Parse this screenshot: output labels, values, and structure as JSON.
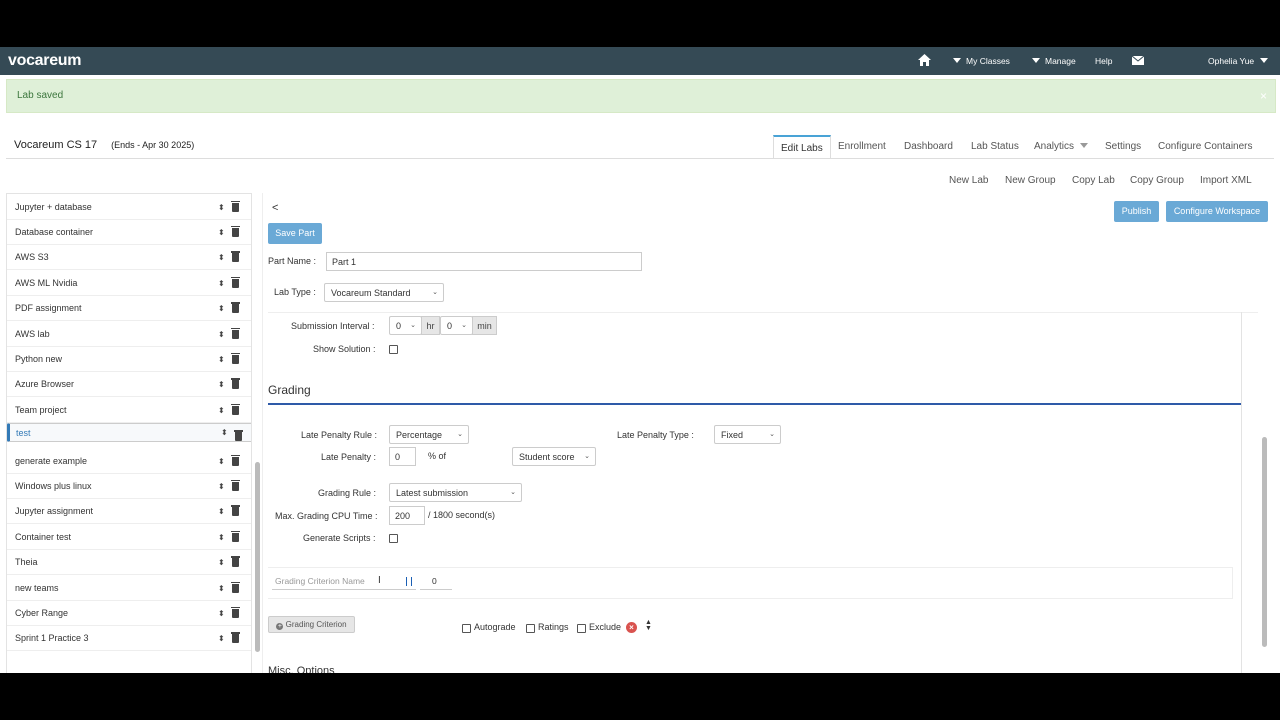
{
  "topbar": {
    "logo": "vocareum",
    "my_classes": "My Classes",
    "manage": "Manage",
    "help": "Help",
    "user": "Ophelia Yue"
  },
  "alert": {
    "text": "Lab saved",
    "close": "×"
  },
  "course": {
    "name": "Vocareum CS 17",
    "ends": "(Ends - Apr 30 2025)"
  },
  "tabs": {
    "edit_labs": "Edit Labs",
    "enrollment": "Enrollment",
    "dashboard": "Dashboard",
    "lab_status": "Lab Status",
    "analytics": "Analytics",
    "settings": "Settings",
    "configure_containers": "Configure Containers"
  },
  "sublinks": {
    "new_lab": "New Lab",
    "new_group": "New Group",
    "copy_lab": "Copy Lab",
    "copy_group": "Copy Group",
    "import_xml": "Import XML"
  },
  "sidebar": {
    "items": [
      {
        "label": "Jupyter + database"
      },
      {
        "label": "Database container"
      },
      {
        "label": "AWS S3"
      },
      {
        "label": "AWS ML Nvidia"
      },
      {
        "label": "PDF assignment"
      },
      {
        "label": "AWS lab"
      },
      {
        "label": "Python new"
      },
      {
        "label": "Azure Browser"
      },
      {
        "label": "Team project"
      },
      {
        "label": "test"
      },
      {
        "label": "generate example"
      },
      {
        "label": "Windows plus linux"
      },
      {
        "label": "Jupyter assignment"
      },
      {
        "label": "Container test"
      },
      {
        "label": "Theia"
      },
      {
        "label": "new teams"
      },
      {
        "label": "Cyber Range"
      },
      {
        "label": "Sprint 1 Practice 3"
      }
    ],
    "selected": "test"
  },
  "main": {
    "back": "<",
    "save_part": "Save Part",
    "publish": "Publish",
    "configure_workspace": "Configure Workspace",
    "part_name_label": "Part Name :",
    "part_name_value": "Part 1",
    "lab_type_label": "Lab Type :",
    "lab_type_value": "Vocareum Standard",
    "submission_interval_label": "Submission Interval :",
    "hr_value": "0",
    "hr_unit": "hr",
    "min_value": "0",
    "min_unit": "min",
    "show_solution_label": "Show Solution :",
    "grading_title": "Grading",
    "late_penalty_rule_label": "Late Penalty Rule :",
    "late_penalty_rule_value": "Percentage",
    "late_penalty_type_label": "Late Penalty Type :",
    "late_penalty_type_value": "Fixed",
    "late_penalty_label": "Late Penalty :",
    "late_penalty_value": "0",
    "pct_of": "% of",
    "student_score": "Student score",
    "grading_rule_label": "Grading Rule :",
    "grading_rule_value": "Latest submission",
    "cpu_time_label": "Max. Grading CPU Time :",
    "cpu_time_value": "200",
    "cpu_time_suffix": "/ 1800 second(s)",
    "generate_scripts_label": "Generate Scripts :",
    "criterion_placeholder": "Grading Criterion Name",
    "criterion_points": "0",
    "autograde": "Autograde",
    "ratings": "Ratings",
    "exclude": "Exclude",
    "add_criterion": "Grading Criterion",
    "misc_options": "Misc. Options"
  }
}
